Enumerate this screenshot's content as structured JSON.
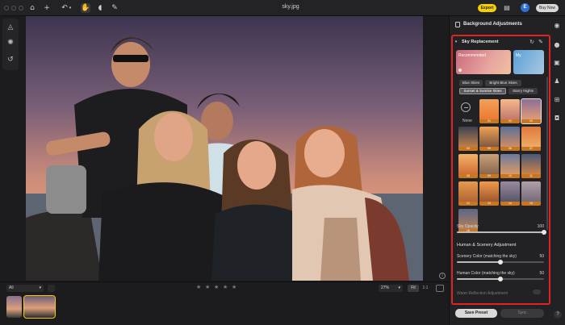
{
  "app": {
    "document_title": "sky.jpg"
  },
  "topbar": {
    "export_label": "Export",
    "buynow_label": "Buy Now",
    "user_initial": "E"
  },
  "bottombar": {
    "filter_value": "All",
    "zoom_value": "27%",
    "fit_label": "Fit",
    "one_to_one_label": "1:1",
    "rating_stars": 5
  },
  "panel": {
    "header": "Background Adjustments",
    "section_title": "Sky Replacement",
    "cards": [
      {
        "label": "Recommended"
      },
      {
        "label": "My"
      }
    ],
    "chips": [
      {
        "label": "Blue Skies",
        "selected": false
      },
      {
        "label": "Bright Blue Skies",
        "selected": false
      },
      {
        "label": "Sunset & Sunrise Skies",
        "selected": true
      },
      {
        "label": "Starry Nights",
        "selected": false
      }
    ],
    "none_label": "None",
    "tiles": [
      {
        "num": "01",
        "top": "#f2a15a",
        "bottom": "#e9722e",
        "selected": false
      },
      {
        "num": "02",
        "top": "#f6b98a",
        "bottom": "#b96a6a",
        "selected": false
      },
      {
        "num": "03",
        "top": "#8a6f99",
        "bottom": "#f2a46d",
        "selected": true
      },
      {
        "num": "04",
        "top": "#3b4252",
        "bottom": "#d98a4a",
        "selected": false
      },
      {
        "num": "05",
        "top": "#f0a256",
        "bottom": "#6a4a3a",
        "selected": false
      },
      {
        "num": "06",
        "top": "#5a6f98",
        "bottom": "#e4925b",
        "selected": false
      },
      {
        "num": "07",
        "top": "#e07a3c",
        "bottom": "#f3b36f",
        "selected": false
      },
      {
        "num": "08",
        "top": "#f4b26a",
        "bottom": "#c8602a",
        "selected": false
      },
      {
        "num": "09",
        "top": "#caa27a",
        "bottom": "#7c5a44",
        "selected": false
      },
      {
        "num": "10",
        "top": "#6b7aa0",
        "bottom": "#f0a05a",
        "selected": false
      },
      {
        "num": "11",
        "top": "#4a5876",
        "bottom": "#e68c40",
        "selected": false
      },
      {
        "num": "12",
        "top": "#e59a4e",
        "bottom": "#a65a30",
        "selected": false
      },
      {
        "num": "13",
        "top": "#f29a4a",
        "bottom": "#8a4a2a",
        "selected": false
      },
      {
        "num": "14",
        "top": "#9a8aa0",
        "bottom": "#4a4a5a",
        "selected": false
      },
      {
        "num": "15",
        "top": "#b0a0a8",
        "bottom": "#6a6070",
        "selected": false
      },
      {
        "num": "16",
        "top": "#5a6688",
        "bottom": "#c9854e",
        "selected": false
      }
    ],
    "sky_opacity": {
      "label": "Sky Opacity",
      "value": 100
    },
    "human_scenery_title": "Human & Scenery Adjustment",
    "scenery_color": {
      "label": "Scenery Color (matching the sky)",
      "value": 50
    },
    "human_color": {
      "label": "Human Color (matching the sky)",
      "value": 50
    },
    "water_reflection_label": "Water Reflection Adjustment",
    "save_preset_label": "Save Preset",
    "sync_label": "Sync"
  },
  "colors": {
    "export": "#f5d000",
    "highlight_frame": "#e02424",
    "avatar": "#2f6fdc"
  }
}
